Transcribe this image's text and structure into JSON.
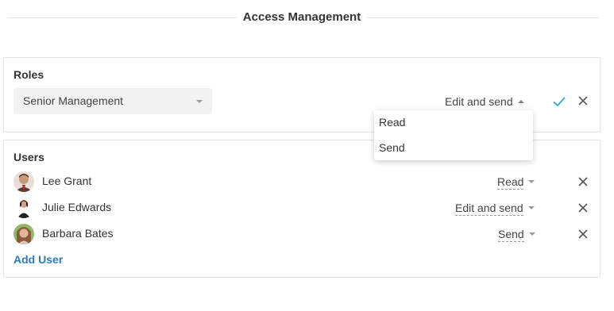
{
  "header": {
    "title": "Access Management"
  },
  "roles": {
    "title": "Roles",
    "selected_role": "Senior Management",
    "permission": "Edit and send"
  },
  "permission_dropdown": {
    "options": [
      "Read",
      "Send"
    ]
  },
  "users": {
    "title": "Users",
    "items": [
      {
        "name": "Lee Grant",
        "permission": "Read"
      },
      {
        "name": "Julie Edwards",
        "permission": "Edit and send"
      },
      {
        "name": "Barbara Bates",
        "permission": "Send"
      }
    ],
    "add_label": "Add User"
  },
  "colors": {
    "accent": "#2a7bbd",
    "confirm": "#3bb0c9"
  }
}
